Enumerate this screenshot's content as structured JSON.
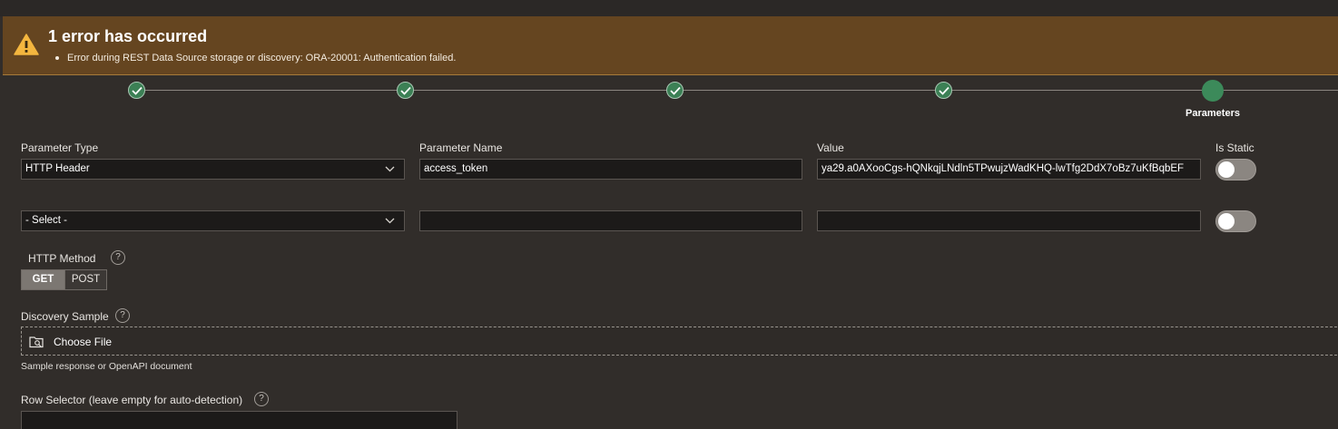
{
  "error": {
    "title": "1 error has occurred",
    "messages": [
      "Error during REST Data Source storage or discovery: ORA-20001: Authentication failed."
    ]
  },
  "wizard": {
    "current_step_label": "Parameters"
  },
  "params": {
    "headers": {
      "type": "Parameter Type",
      "name": "Parameter Name",
      "value": "Value",
      "static": "Is Static"
    },
    "rows": [
      {
        "type": "HTTP Header",
        "name": "access_token",
        "value": "ya29.a0AXooCgs-hQNkqjLNdln5TPwujzWadKHQ-lwTfg2DdX7oBz7uKfBqbEF",
        "is_static": false
      },
      {
        "type": "- Select -",
        "name": "",
        "value": "",
        "is_static": false
      }
    ]
  },
  "http_method": {
    "label": "HTTP Method",
    "options": [
      "GET",
      "POST"
    ],
    "selected": "GET"
  },
  "discovery": {
    "label": "Discovery Sample",
    "button": "Choose File",
    "hint": "Sample response or OpenAPI document"
  },
  "row_selector": {
    "label": "Row Selector (leave empty for auto-detection)",
    "value": ""
  },
  "help_glyph": "?"
}
